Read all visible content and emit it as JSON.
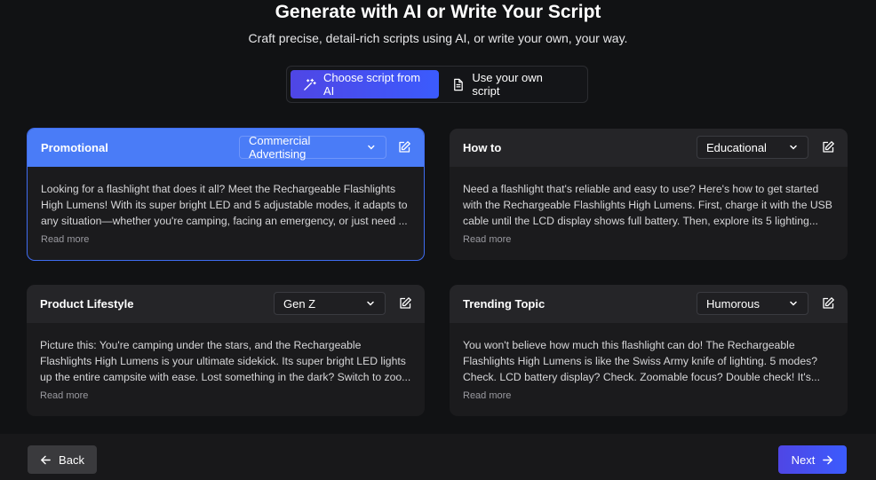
{
  "header": {
    "title": "Generate with AI or Write Your Script",
    "subtitle": "Craft precise, detail-rich scripts using AI, or write your own, your way."
  },
  "toggle": {
    "ai_label": "Choose script from AI",
    "own_label": "Use your own script",
    "active": "ai"
  },
  "cards": [
    {
      "title": "Promotional",
      "tone": "Commercial Advertising",
      "text": "Looking for a flashlight that does it all? Meet the Rechargeable Flashlights High Lumens! With its super bright LED and 5 adjustable modes, it adapts to any situation—whether you're camping, facing an emergency, or just need ...",
      "read_more": "Read more",
      "selected": true
    },
    {
      "title": "How to",
      "tone": "Educational",
      "text": "Need a flashlight that's reliable and easy to use? Here's how to get started with the Rechargeable Flashlights High Lumens. First, charge it with the USB cable until the LCD display shows full battery. Then, explore its 5 lighting...",
      "read_more": "Read more",
      "selected": false
    },
    {
      "title": "Product Lifestyle",
      "tone": "Gen Z",
      "text": "Picture this: You're camping under the stars, and the Rechargeable Flashlights High Lumens is your ultimate sidekick. Its super bright LED lights up the entire campsite with ease. Lost something in the dark? Switch to zoo...",
      "read_more": "Read more",
      "selected": false
    },
    {
      "title": "Trending Topic",
      "tone": "Humorous",
      "text": "You won't believe how much this flashlight can do! The Rechargeable Flashlights High Lumens is like the Swiss Army knife of lighting. 5 modes? Check. LCD battery display? Check. Zoomable focus? Double check! It's...",
      "read_more": "Read more",
      "selected": false
    }
  ],
  "footer": {
    "back_label": "Back",
    "next_label": "Next"
  },
  "colors": {
    "accent": "#4a7cf7",
    "gradient_start": "#4f46e5",
    "gradient_end": "#3b5bfd",
    "background": "#111214"
  }
}
